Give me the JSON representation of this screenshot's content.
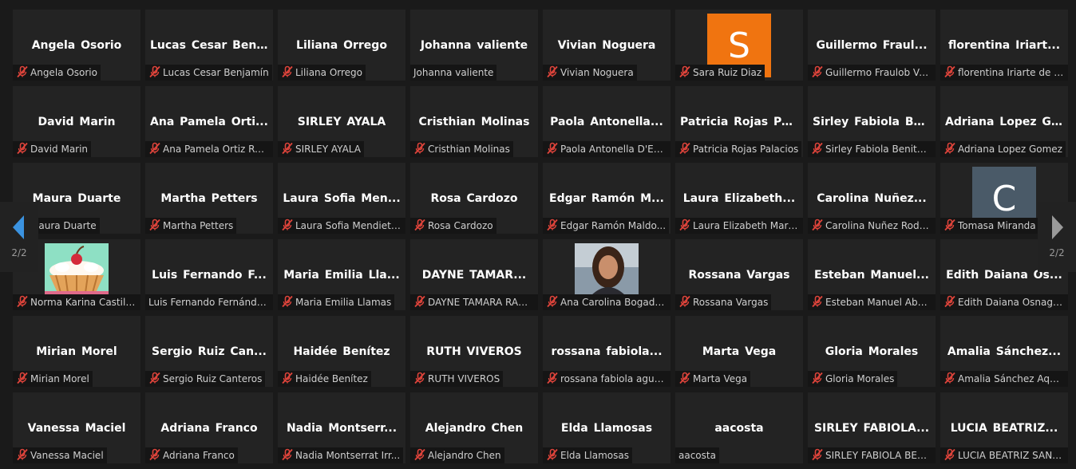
{
  "nav": {
    "page_left": "2/2",
    "page_right": "2/2",
    "prev_icon": "triangle-left-icon",
    "next_icon": "triangle-right-icon"
  },
  "colors": {
    "muted_icon": "#e0443b",
    "tile_bg": "#232323",
    "label_bg": "#151515",
    "avatar_orange": "#f07410",
    "avatar_slate": "#4a5a68",
    "nav_arrow_active": "#3b93e0"
  },
  "tiles": [
    {
      "display": "Angela Osorio",
      "label": "Angela Osorio",
      "muted": true
    },
    {
      "display": "Lucas Cesar Ben...",
      "label": "Lucas Cesar Benjamín",
      "muted": true
    },
    {
      "display": "Liliana Orrego",
      "label": "Liliana Orrego",
      "muted": true
    },
    {
      "display": "Johanna valiente",
      "label": "Johanna valiente",
      "muted": false
    },
    {
      "display": "Vivian Noguera",
      "label": "Vivian Noguera",
      "muted": true
    },
    {
      "display": "",
      "label": "Sara Ruiz Diaz",
      "muted": true,
      "avatar": "S",
      "avatar_color": "#f07410"
    },
    {
      "display": "Guillermo Fraul...",
      "label": "Guillermo Fraulob Val...",
      "muted": true
    },
    {
      "display": "florentina Iriart...",
      "label": "florentina Iriarte de O...",
      "muted": true
    },
    {
      "display": "David Marin",
      "label": "David Marin",
      "muted": true
    },
    {
      "display": "Ana Pamela Orti...",
      "label": "Ana Pamela Ortiz Roj...",
      "muted": true
    },
    {
      "display": "SIRLEY AYALA",
      "label": "SIRLEY AYALA",
      "muted": true
    },
    {
      "display": "Cristhian Molinas",
      "label": "Cristhian Molinas",
      "muted": true
    },
    {
      "display": "Paola Antonella...",
      "label": "Paola Antonella D'Ecc...",
      "muted": true
    },
    {
      "display": "Patricia Rojas Pa...",
      "label": "Patricia Rojas Palacios",
      "muted": true
    },
    {
      "display": "Sirley Fabiola Be...",
      "label": "Sirley Fabiola Benitez ...",
      "muted": true
    },
    {
      "display": "Adriana Lopez G...",
      "label": "Adriana Lopez Gomez",
      "muted": true
    },
    {
      "display": "Maura Duarte",
      "label": "Maura Duarte",
      "muted": true
    },
    {
      "display": "Martha Petters",
      "label": "Martha Petters",
      "muted": true
    },
    {
      "display": "Laura Sofia Men...",
      "label": "Laura Sofia Mendieta...",
      "muted": true
    },
    {
      "display": "Rosa Cardozo",
      "label": "Rosa Cardozo",
      "muted": true
    },
    {
      "display": "Edgar Ramón M...",
      "label": "Edgar Ramón Maldo...",
      "muted": true
    },
    {
      "display": "Laura Elizabeth...",
      "label": "Laura Elizabeth Marin...",
      "muted": true
    },
    {
      "display": "Carolina Nuñez...",
      "label": "Carolina Nuñez Rodri...",
      "muted": true
    },
    {
      "display": "",
      "label": "Tomasa Miranda",
      "muted": true,
      "avatar": "C",
      "avatar_color": "#4a5a68"
    },
    {
      "display": "",
      "label": "Norma Karina Castill...",
      "muted": true,
      "photo": "cupcake"
    },
    {
      "display": "Luis Fernando F...",
      "label": "Luis Fernando Fernánde...",
      "muted": false
    },
    {
      "display": "Maria Emilia Lla...",
      "label": "Maria Emilia Llamas",
      "muted": true
    },
    {
      "display": "DAYNE TAMAR...",
      "label": "DAYNE TAMARA RAM...",
      "muted": true
    },
    {
      "display": "",
      "label": "Ana Carolina Bogado...",
      "muted": true,
      "photo": "portrait"
    },
    {
      "display": "Rossana Vargas",
      "label": "Rossana Vargas",
      "muted": true
    },
    {
      "display": "Esteban Manuel...",
      "label": "Esteban Manuel Abb...",
      "muted": true
    },
    {
      "display": "Edith Daiana Os...",
      "label": "Edith Daiana Osnaghi...",
      "muted": true
    },
    {
      "display": "Mirian Morel",
      "label": "Mirian Morel",
      "muted": true
    },
    {
      "display": "Sergio Ruiz Can...",
      "label": "Sergio Ruiz Canteros",
      "muted": true
    },
    {
      "display": "Haidée Benítez",
      "label": "Haidée Benítez",
      "muted": true
    },
    {
      "display": "RUTH VIVEROS",
      "label": "RUTH VIVEROS",
      "muted": true
    },
    {
      "display": "rossana fabiola...",
      "label": "rossana fabiola ague...",
      "muted": true
    },
    {
      "display": "Marta Vega",
      "label": "Marta Vega",
      "muted": true
    },
    {
      "display": "Gloria Morales",
      "label": "Gloria Morales",
      "muted": true
    },
    {
      "display": "Amalia Sánchez...",
      "label": "Amalia Sánchez Aquino",
      "muted": true
    },
    {
      "display": "Vanessa Maciel",
      "label": "Vanessa Maciel",
      "muted": true
    },
    {
      "display": "Adriana Franco",
      "label": "Adriana Franco",
      "muted": true
    },
    {
      "display": "Nadia Montserr...",
      "label": "Nadia Montserrat Irr...",
      "muted": true
    },
    {
      "display": "Alejandro Chen",
      "label": "Alejandro Chen",
      "muted": true
    },
    {
      "display": "Elda Llamosas",
      "label": "Elda Llamosas",
      "muted": true
    },
    {
      "display": "aacosta",
      "label": "aacosta",
      "muted": false
    },
    {
      "display": "SIRLEY FABIOLA...",
      "label": "SIRLEY FABIOLA BENI...",
      "muted": true
    },
    {
      "display": "LUCIA BEATRIZ...",
      "label": "LUCIA BEATRIZ SANG...",
      "muted": true
    }
  ]
}
